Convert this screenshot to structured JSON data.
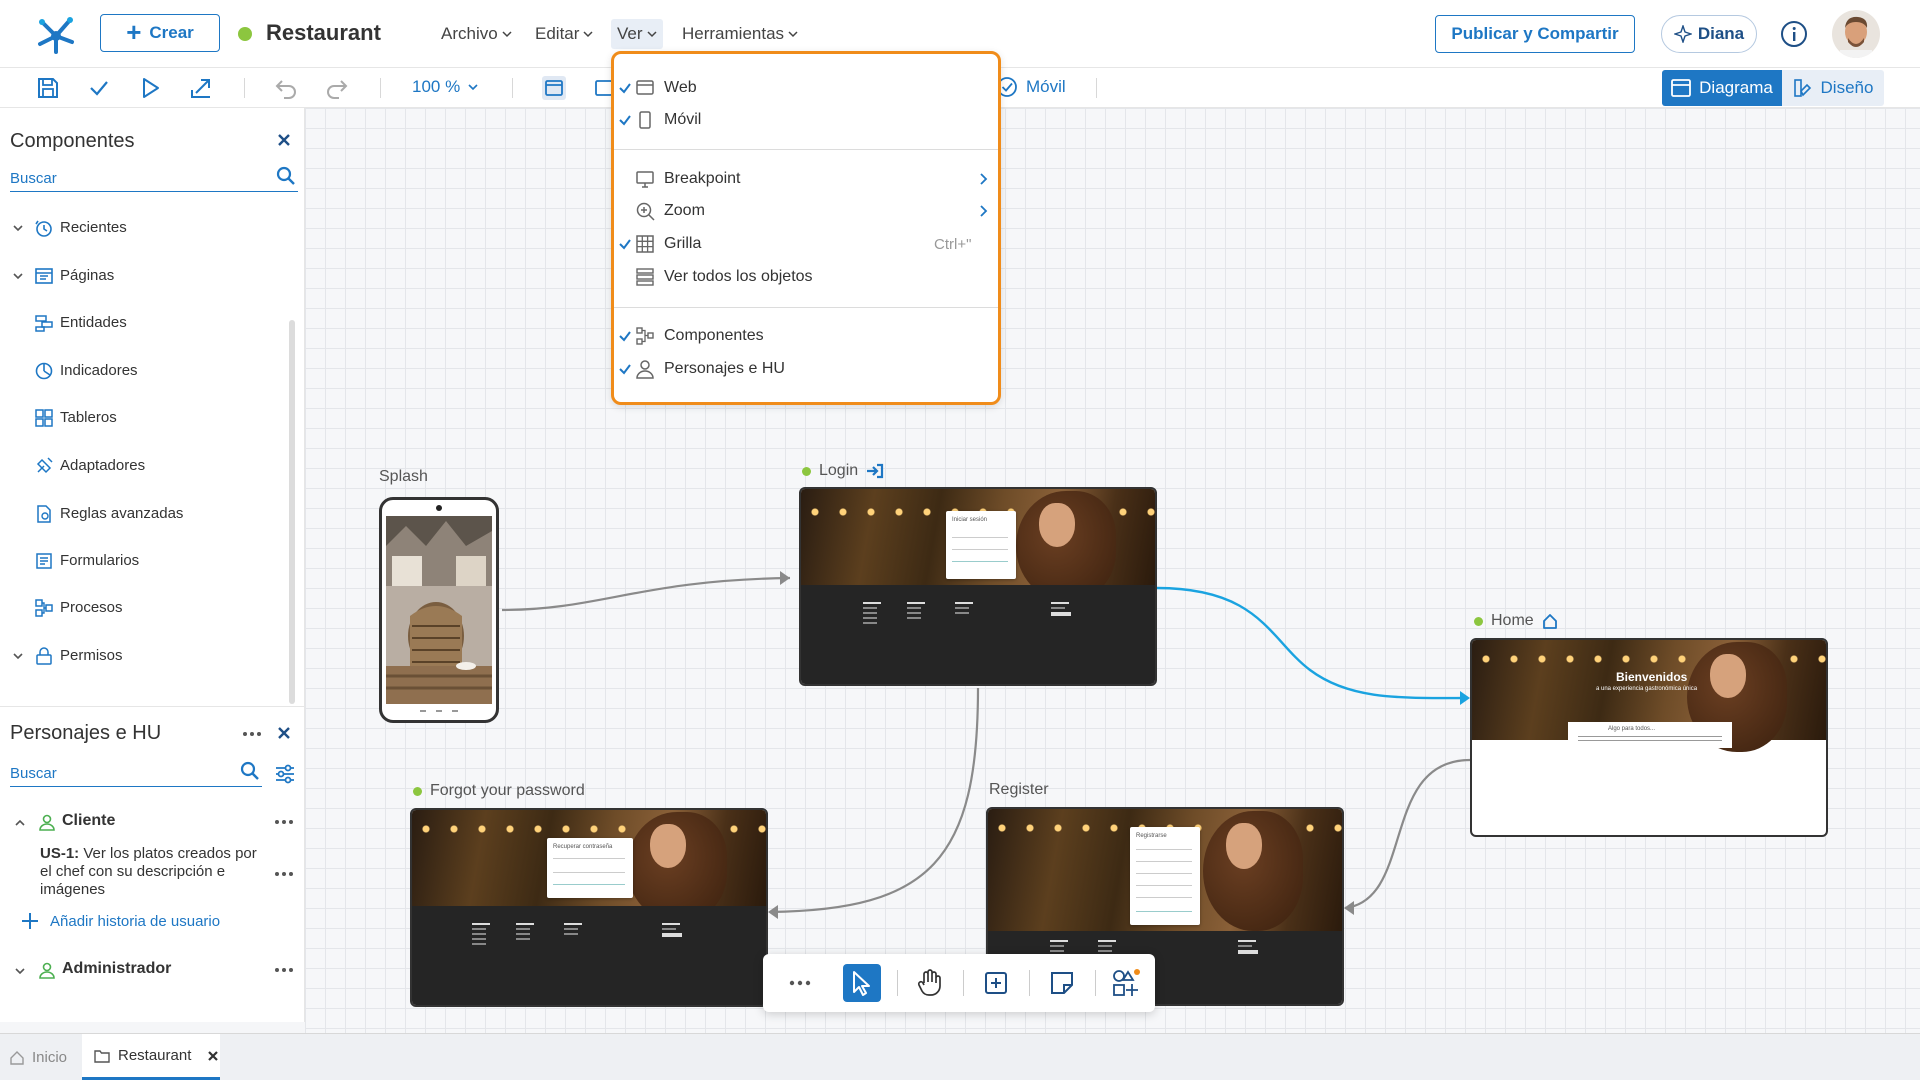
{
  "header": {
    "crear_label": "Crear",
    "app_title": "Restaurant",
    "menus": [
      "Archivo",
      "Editar",
      "Ver",
      "Herramientas"
    ],
    "publish_label": "Publicar y Compartir",
    "assistant_label": "Diana"
  },
  "toolbar": {
    "zoom_level": "100 %",
    "movil_label": "Móvil",
    "diagram_label": "Diagrama",
    "design_label": "Diseño"
  },
  "components_panel": {
    "title": "Componentes",
    "search_placeholder": "Buscar",
    "items": [
      "Recientes",
      "Páginas",
      "Entidades",
      "Indicadores",
      "Tableros",
      "Adaptadores",
      "Reglas avanzadas",
      "Formularios",
      "Procesos",
      "Permisos"
    ]
  },
  "personas_panel": {
    "title": "Personajes e HU",
    "search_placeholder": "Buscar",
    "personas": [
      "Cliente",
      "Administrador"
    ],
    "story_id": "US-1:",
    "story_text": "Ver los platos creados por el chef con su descripción e imágenes",
    "add_story_label": "Añadir historia de usuario"
  },
  "view_menu": {
    "items": [
      {
        "label": "Web",
        "checked": true
      },
      {
        "label": "Móvil",
        "checked": true
      },
      {
        "label": "Breakpoint",
        "checked": false
      },
      {
        "label": "Zoom",
        "checked": false
      },
      {
        "label": "Grilla",
        "checked": true,
        "shortcut": "Ctrl+\""
      },
      {
        "label": "Ver todos los objetos",
        "checked": false
      },
      {
        "label": "Componentes",
        "checked": true
      },
      {
        "label": "Personajes e HU",
        "checked": true
      }
    ]
  },
  "diagram": {
    "nodes": {
      "splash": "Splash",
      "login": "Login",
      "home": "Home",
      "forgot": "Forgot your password",
      "register": "Register"
    },
    "mini_text": {
      "login_form_title": "Iniciar sesión",
      "forgot_form_title": "Recuperar contraseña",
      "register_form_title": "Registrarse",
      "home_heading": "Bienvenidos",
      "home_subheading": "a una experiencia gastronómica única",
      "home_section": "Algo para todos..."
    }
  },
  "tabs": {
    "home_label": "Inicio",
    "project_label": "Restaurant"
  },
  "colors": {
    "accent": "#1e77c4",
    "highlight_orange": "#f08c1a",
    "status_green": "#8cc63f",
    "connector_blue": "#1aa3e0",
    "connector_gray": "#8a8a8a"
  }
}
